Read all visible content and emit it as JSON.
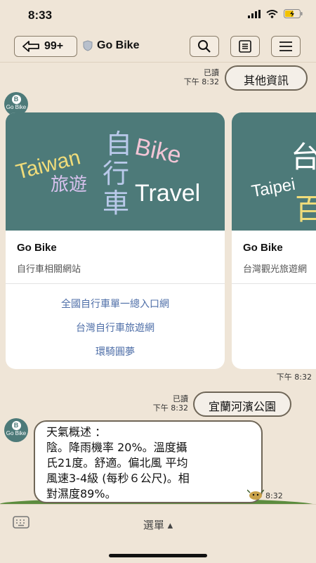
{
  "status": {
    "time": "8:33"
  },
  "nav": {
    "back_count": "99+",
    "title": "Go Bike",
    "buttons": [
      "search-icon",
      "notes-icon",
      "menu-icon"
    ]
  },
  "messages": {
    "msg1": {
      "text": "其他資訊",
      "read": "已讀",
      "time": "下午 8:32"
    },
    "cards": [
      {
        "hero": {
          "words": [
            "Taiwan",
            "自",
            "行",
            "車",
            "Bike",
            "旅遊",
            "Travel"
          ]
        },
        "title": "Go Bike",
        "subtitle": "自行車相關網站",
        "links": [
          "全國自行車單一總入口網",
          "台灣自行車旅遊網",
          "環騎圓夢"
        ]
      },
      {
        "hero": {
          "words": [
            "Taipei",
            "台",
            "百"
          ]
        },
        "title": "Go Bike",
        "subtitle": "台灣觀光旅遊網"
      }
    ],
    "cards_time": "下午 8:32",
    "msg2": {
      "text": "宜蘭河濱公園",
      "read": "已讀",
      "time": "下午 8:32"
    },
    "weather": {
      "lines": [
        "天氣概述 ：",
        "陰。降雨機率 20%。溫度攝",
        "氏21度。舒適。偏北風 平均",
        "風速3-4級 (每秒６公尺)。相",
        "對濕度89%。"
      ],
      "time": "8:32"
    },
    "avatar_label": "Go Bike",
    "avatar_letter": "B"
  },
  "bottom": {
    "menu_label": "選單 ▴"
  },
  "colors": {
    "background": "#efe5d7",
    "hero": "#4d7a79",
    "link": "#4f6fa8",
    "grass": "#5c8c3e"
  }
}
